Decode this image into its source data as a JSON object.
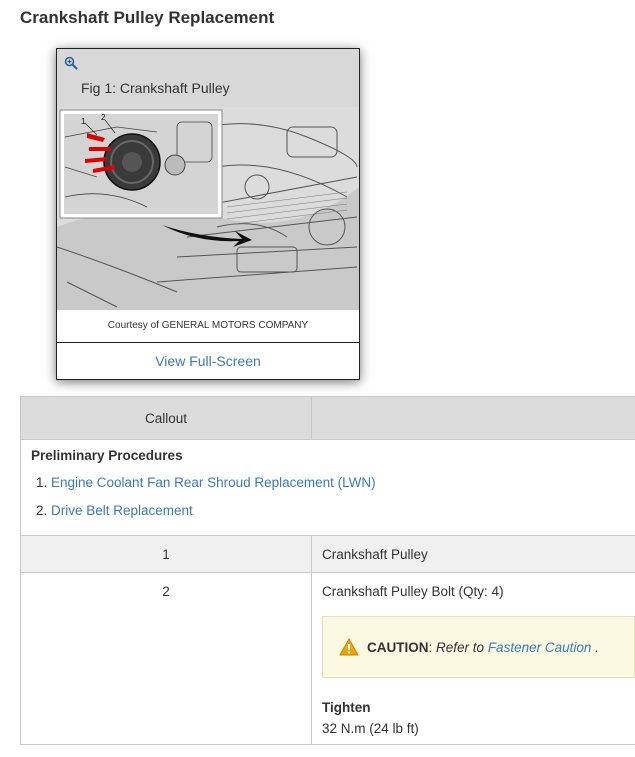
{
  "page": {
    "title": "Crankshaft Pulley Replacement"
  },
  "figure": {
    "caption": "Fig 1: Crankshaft Pulley",
    "credit": "Courtesy of GENERAL MOTORS COMPANY",
    "view_full_screen": "View Full-Screen",
    "callout_labels": [
      "1",
      "2"
    ],
    "icon": "zoom-in-icon"
  },
  "table": {
    "header": {
      "callout": "Callout",
      "component": ""
    },
    "preliminary": {
      "title": "Preliminary Procedures",
      "items": [
        "Engine Coolant Fan Rear Shroud Replacement (LWN)",
        "Drive Belt Replacement"
      ]
    },
    "rows": [
      {
        "callout": "1",
        "component": "Crankshaft Pulley"
      },
      {
        "callout": "2",
        "component": "Crankshaft Pulley Bolt (Qty: 4)",
        "caution": {
          "label": "CAUTION",
          "text": "Refer to",
          "link": "Fastener Caution",
          "end": ".",
          "icon": "warning-icon"
        },
        "tighten_label": "Tighten",
        "torque": "32 N.m (24 lb ft)"
      }
    ]
  },
  "colors": {
    "link": "#3b7ab8",
    "header_bg": "#dcdcdc",
    "caution_bg": "#fcf9e3",
    "warning": "#f0a30a"
  }
}
